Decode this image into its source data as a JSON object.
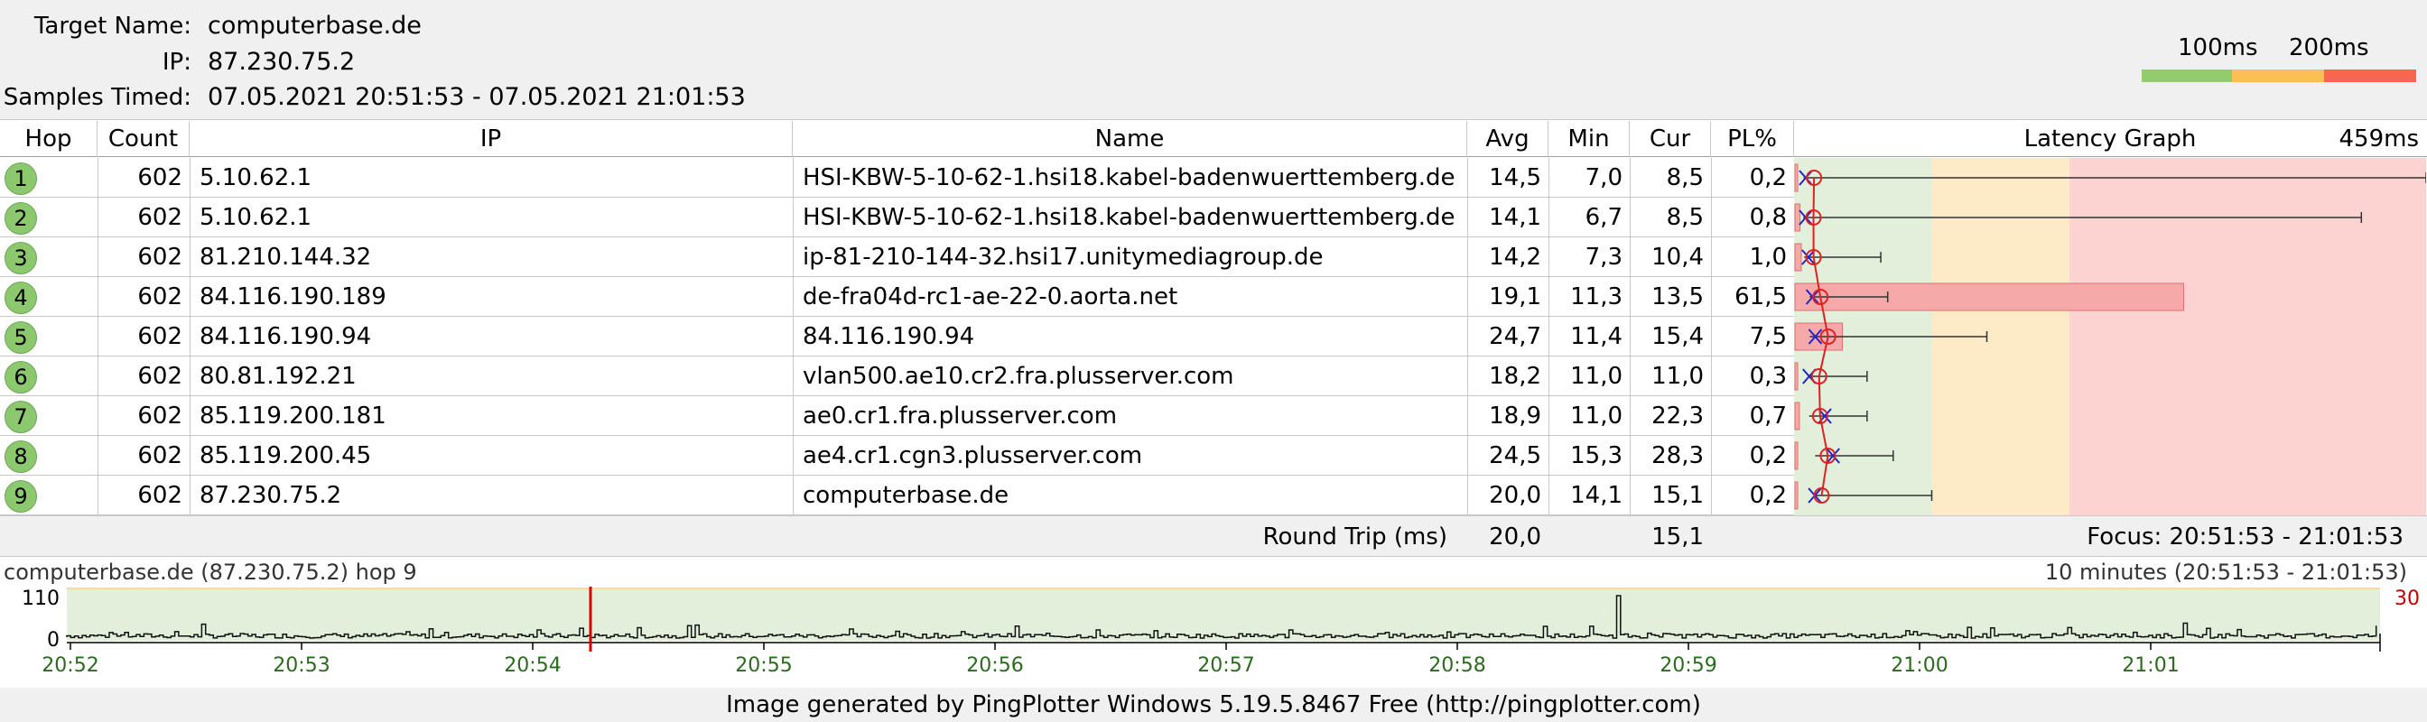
{
  "header": {
    "target_name_label": "Target Name:",
    "target_name": "computerbase.de",
    "ip_label": "IP:",
    "ip": "87.230.75.2",
    "samples_label": "Samples Timed:",
    "samples": "07.05.2021 20:51:53 - 07.05.2021 21:01:53",
    "legend_100": "100ms",
    "legend_200": "200ms",
    "legend_colors": [
      "#92cc6f",
      "#fcbf55",
      "#f8664f"
    ]
  },
  "table": {
    "columns": {
      "hop": "Hop",
      "count": "Count",
      "ip": "IP",
      "name": "Name",
      "avg": "Avg",
      "min": "Min",
      "cur": "Cur",
      "pl": "PL%",
      "graph": "Latency Graph",
      "graph_max": "459ms"
    },
    "rows": [
      {
        "hop": "1",
        "count": "602",
        "ip": "5.10.62.1",
        "name": "HSI-KBW-5-10-62-1.hsi18.kabel-badenwuerttemberg.de",
        "avg": "14,5",
        "min": "7,0",
        "cur": "8,5",
        "pl": "0,2"
      },
      {
        "hop": "2",
        "count": "602",
        "ip": "5.10.62.1",
        "name": "HSI-KBW-5-10-62-1.hsi18.kabel-badenwuerttemberg.de",
        "avg": "14,1",
        "min": "6,7",
        "cur": "8,5",
        "pl": "0,8"
      },
      {
        "hop": "3",
        "count": "602",
        "ip": "81.210.144.32",
        "name": "ip-81-210-144-32.hsi17.unitymediagroup.de",
        "avg": "14,2",
        "min": "7,3",
        "cur": "10,4",
        "pl": "1,0"
      },
      {
        "hop": "4",
        "count": "602",
        "ip": "84.116.190.189",
        "name": "de-fra04d-rc1-ae-22-0.aorta.net",
        "avg": "19,1",
        "min": "11,3",
        "cur": "13,5",
        "pl": "61,5"
      },
      {
        "hop": "5",
        "count": "602",
        "ip": "84.116.190.94",
        "name": "84.116.190.94",
        "avg": "24,7",
        "min": "11,4",
        "cur": "15,4",
        "pl": "7,5"
      },
      {
        "hop": "6",
        "count": "602",
        "ip": "80.81.192.21",
        "name": "vlan500.ae10.cr2.fra.plusserver.com",
        "avg": "18,2",
        "min": "11,0",
        "cur": "11,0",
        "pl": "0,3"
      },
      {
        "hop": "7",
        "count": "602",
        "ip": "85.119.200.181",
        "name": "ae0.cr1.fra.plusserver.com",
        "avg": "18,9",
        "min": "11,0",
        "cur": "22,3",
        "pl": "0,7"
      },
      {
        "hop": "8",
        "count": "602",
        "ip": "85.119.200.45",
        "name": "ae4.cr1.cgn3.plusserver.com",
        "avg": "24,5",
        "min": "15,3",
        "cur": "28,3",
        "pl": "0,2"
      },
      {
        "hop": "9",
        "count": "602",
        "ip": "87.230.75.2",
        "name": "computerbase.de",
        "avg": "20,0",
        "min": "14,1",
        "cur": "15,1",
        "pl": "0,2"
      }
    ],
    "graph_max_ms": 459,
    "graph_max_latency": [
      459,
      412,
      63,
      68,
      140,
      53,
      53,
      72,
      100
    ],
    "graph_colors": {
      "green": "#e2efda",
      "yellow": "#fdebc8",
      "red": "#fdd3d2"
    }
  },
  "roundtrip": {
    "label": "Round Trip (ms)",
    "avg": "20,0",
    "cur": "15,1",
    "focus": "Focus: 20:51:53 - 21:01:53"
  },
  "timeline": {
    "title": "computerbase.de (87.230.75.2) hop 9",
    "range": "10 minutes (20:51:53 - 21:01:53)",
    "y_top": "110",
    "y_bottom": "0",
    "right_label": "30",
    "ticks": [
      "20:52",
      "20:53",
      "20:54",
      "20:55",
      "20:56",
      "20:57",
      "20:58",
      "20:59",
      "21:00",
      "21:01"
    ],
    "marker_minute": 2.25,
    "spike_minute": 6.7
  },
  "footer": {
    "text": "Image generated by PingPlotter Windows 5.19.5.8467 Free (http://pingplotter.com)"
  }
}
